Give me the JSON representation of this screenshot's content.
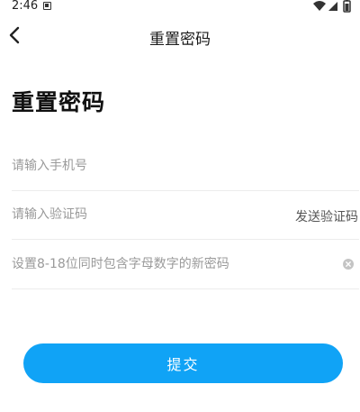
{
  "status_bar": {
    "time": "2:46",
    "icons": [
      "notification-icon",
      "wifi-icon",
      "cell-signal-icon",
      "battery-icon"
    ]
  },
  "nav": {
    "title": "重置密码",
    "back_icon": "chevron-left-icon"
  },
  "page": {
    "heading": "重置密码"
  },
  "form": {
    "phone_placeholder": "请输入手机号",
    "phone_value": "",
    "code_placeholder": "请输入验证码",
    "code_value": "",
    "send_code_label": "发送验证码",
    "password_placeholder": "设置8-18位同时包含字母数字的新密码",
    "password_value": ""
  },
  "submit": {
    "label": "提交"
  },
  "colors": {
    "accent": "#10a3f6",
    "divider": "#ececec",
    "placeholder": "#9a9a9a"
  }
}
